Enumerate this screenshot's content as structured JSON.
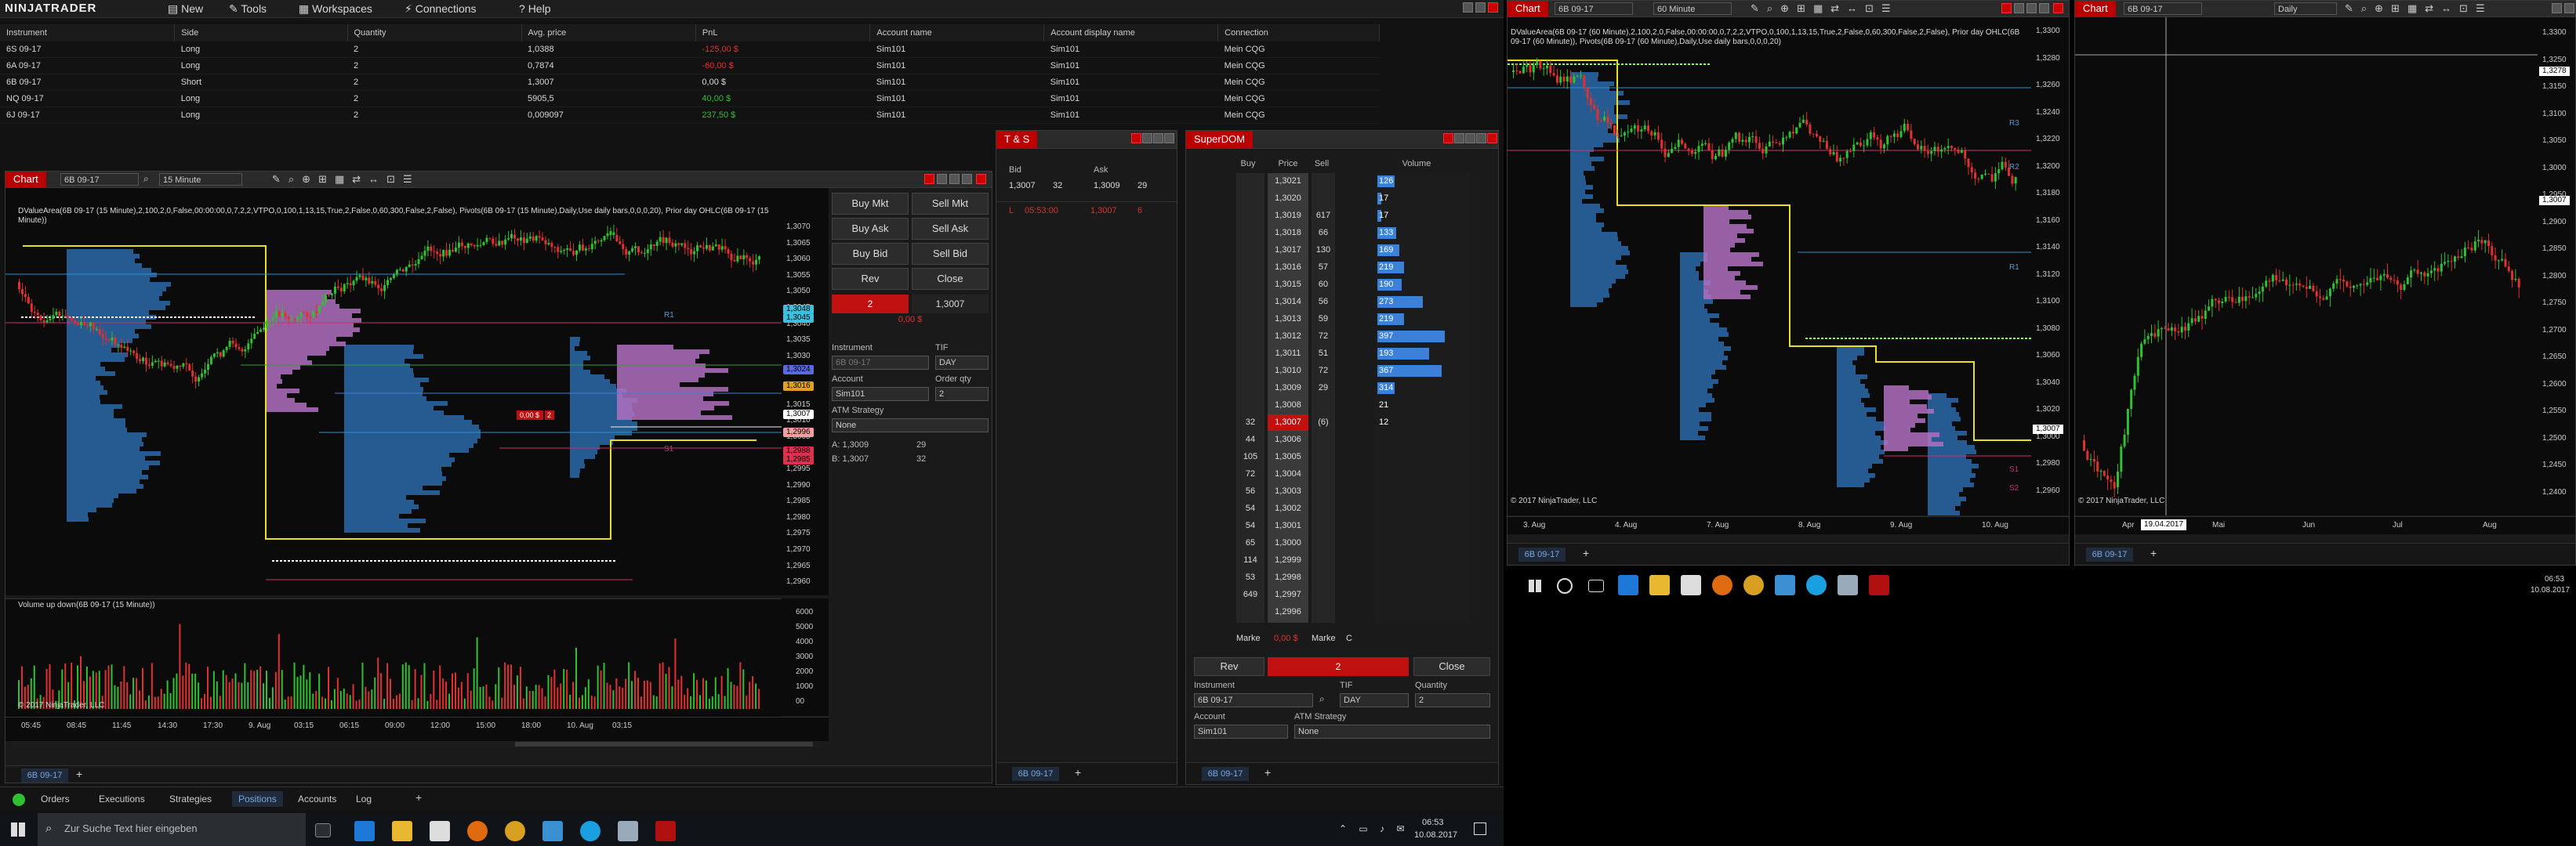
{
  "app": {
    "brand": "NINJATRADER",
    "menu": [
      "New",
      "Tools",
      "Workspaces",
      "Connections",
      "Help"
    ]
  },
  "positions": {
    "columns": [
      "Instrument",
      "Side",
      "Quantity",
      "Avg. price",
      "PnL",
      "Account name",
      "Account display name",
      "Connection"
    ],
    "rows": [
      {
        "instrument": "6S 09-17",
        "side": "Long",
        "qty": "2",
        "avg": "1,0388",
        "pnl": "-125,00 $",
        "pnl_color": "#e03030",
        "account": "Sim101",
        "display": "Sim101",
        "connection": "Mein CQG"
      },
      {
        "instrument": "6A 09-17",
        "side": "Long",
        "qty": "2",
        "avg": "0,7874",
        "pnl": "-60,00 $",
        "pnl_color": "#e03030",
        "account": "Sim101",
        "display": "Sim101",
        "connection": "Mein CQG"
      },
      {
        "instrument": "6B 09-17",
        "side": "Short",
        "qty": "2",
        "avg": "1,3007",
        "pnl": "0,00 $",
        "pnl_color": "#d8d8d8",
        "account": "Sim101",
        "display": "Sim101",
        "connection": "Mein CQG"
      },
      {
        "instrument": "NQ 09-17",
        "side": "Long",
        "qty": "2",
        "avg": "5905,5",
        "pnl": "40,00 $",
        "pnl_color": "#2ec02e",
        "account": "Sim101",
        "display": "Sim101",
        "connection": "Mein CQG"
      },
      {
        "instrument": "6J 09-17",
        "side": "Long",
        "qty": "2",
        "avg": "0,009097",
        "pnl": "237,50 $",
        "pnl_color": "#2ec02e",
        "account": "Sim101",
        "display": "Sim101",
        "connection": "Mein CQG"
      }
    ]
  },
  "chart1": {
    "tab": "Chart",
    "instrument": "6B 09-17",
    "interval": "15 Minute",
    "indicator_text": "DValueArea(6B 09-17 (15 Minute),2,100,2,0,False,00:00:00,0,7,2,2,VTPO,0,100,1,13,15,True,2,False,0,60,300,False,2,False), Pivots(6B 09-17 (15 Minute),Daily,Use daily bars,0,0,0,20), Prior day OHLC(6B 09-17 (15 Minute))",
    "copyright": "© 2017 NinjaTrader, LLC",
    "volume_label": "Volume up down(6B 09-17 (15 Minute))",
    "price_axis": [
      "1,3070",
      "1,3065",
      "1,3060",
      "1,3055",
      "1,3050",
      "1,3045",
      "1,3040",
      "1,3035",
      "1,3030",
      "1,3025",
      "1,3020",
      "1,3015",
      "1,3010",
      "1,3005",
      "1,3000",
      "1,2995",
      "1,2990",
      "1,2985",
      "1,2980",
      "1,2975",
      "1,2970",
      "1,2965",
      "1,2960"
    ],
    "price_tags": [
      {
        "text": "1,3048",
        "color": "#3cc0e0"
      },
      {
        "text": "1,3045",
        "color": "#3cc0e0"
      },
      {
        "text": "1,3024",
        "color": "#5a6ad8"
      },
      {
        "text": "1,3016",
        "color": "#e0a020"
      },
      {
        "text": "1,3007",
        "color": "#ffffff"
      },
      {
        "text": "1,2996",
        "color": "#f0a0a0"
      },
      {
        "text": "1,2988",
        "color": "#e03050"
      },
      {
        "text": "1,2985",
        "color": "#e03050"
      }
    ],
    "volume_axis": [
      "6000",
      "5000",
      "4000",
      "3000",
      "2000",
      "1000",
      "00"
    ],
    "time_axis": [
      "05:45",
      "08:45",
      "11:45",
      "14:30",
      "17:30",
      "9. Aug",
      "03:15",
      "06:15",
      "09:00",
      "12:00",
      "15:00",
      "18:00",
      "10. Aug",
      "03:15"
    ],
    "r1": "R1",
    "s1": "S1",
    "order_marker": "0,00 $",
    "order_qty": "2",
    "bottom_tab": "6B 09-17"
  },
  "chart_trader": {
    "buy_mkt": "Buy Mkt",
    "sell_mkt": "Sell Mkt",
    "buy_ask": "Buy Ask",
    "sell_ask": "Sell Ask",
    "buy_bid": "Buy Bid",
    "sell_bid": "Sell Bid",
    "rev": "Rev",
    "close": "Close",
    "pos_qty": "2",
    "pos_price": "1,3007",
    "pos_pnl": "0,00 $",
    "instrument_label": "Instrument",
    "instrument": "6B 09-17",
    "tif_label": "TIF",
    "tif": "DAY",
    "account_label": "Account",
    "account": "Sim101",
    "qty_label": "Order qty",
    "qty": "2",
    "atm_label": "ATM Strategy",
    "atm": "None",
    "a_label": "A:",
    "a_price": "1,3009",
    "a_size": "29",
    "b_label": "B:",
    "b_price": "1,3007",
    "b_size": "32"
  },
  "ts": {
    "title": "T & S",
    "bid_label": "Bid",
    "ask_label": "Ask",
    "bid": "1,3007",
    "bid_size": "32",
    "ask": "1,3009",
    "ask_size": "29",
    "row_marker": "L",
    "row_time": "05:53:00",
    "row_price": "1,3007",
    "row_size": "6",
    "bottom_tab": "6B 09-17"
  },
  "superdom": {
    "title": "SuperDOM",
    "cols": [
      "Buy",
      "Price",
      "Sell",
      "Volume"
    ],
    "rows": [
      {
        "buy": "",
        "price": "1,3021",
        "sell": "",
        "vol": "126",
        "vw": 22
      },
      {
        "buy": "",
        "price": "1,3020",
        "sell": "",
        "vol": "17",
        "vw": 5
      },
      {
        "buy": "",
        "price": "1,3019",
        "sell": "617",
        "vol": "17",
        "vw": 5
      },
      {
        "buy": "",
        "price": "1,3018",
        "sell": "66",
        "vol": "133",
        "vw": 24
      },
      {
        "buy": "",
        "price": "1,3017",
        "sell": "130",
        "vol": "169",
        "vw": 28
      },
      {
        "buy": "",
        "price": "1,3016",
        "sell": "57",
        "vol": "219",
        "vw": 34
      },
      {
        "buy": "",
        "price": "1,3015",
        "sell": "60",
        "vol": "190",
        "vw": 31
      },
      {
        "buy": "",
        "price": "1,3014",
        "sell": "56",
        "vol": "273",
        "vw": 58
      },
      {
        "buy": "",
        "price": "1,3013",
        "sell": "59",
        "vol": "219",
        "vw": 34
      },
      {
        "buy": "",
        "price": "1,3012",
        "sell": "72",
        "vol": "397",
        "vw": 86
      },
      {
        "buy": "",
        "price": "1,3011",
        "sell": "51",
        "vol": "193",
        "vw": 66
      },
      {
        "buy": "",
        "price": "1,3010",
        "sell": "72",
        "vol": "367",
        "vw": 82
      },
      {
        "buy": "",
        "price": "1,3009",
        "sell": "29",
        "vol": "314",
        "vw": 22
      },
      {
        "buy": "",
        "price": "1,3008",
        "sell": "",
        "vol": "21",
        "vw": 0
      },
      {
        "buy": "32",
        "price": "1,3007",
        "sell": "(6)",
        "vol": "12",
        "vw": 0
      },
      {
        "buy": "44",
        "price": "1,3006",
        "sell": "",
        "vol": "",
        "vw": 0
      },
      {
        "buy": "105",
        "price": "1,3005",
        "sell": "",
        "vol": "",
        "vw": 0
      },
      {
        "buy": "72",
        "price": "1,3004",
        "sell": "",
        "vol": "",
        "vw": 0
      },
      {
        "buy": "56",
        "price": "1,3003",
        "sell": "",
        "vol": "",
        "vw": 0
      },
      {
        "buy": "54",
        "price": "1,3002",
        "sell": "",
        "vol": "",
        "vw": 0
      },
      {
        "buy": "54",
        "price": "1,3001",
        "sell": "",
        "vol": "",
        "vw": 0
      },
      {
        "buy": "65",
        "price": "1,3000",
        "sell": "",
        "vol": "",
        "vw": 0
      },
      {
        "buy": "114",
        "price": "1,2999",
        "sell": "",
        "vol": "",
        "vw": 0
      },
      {
        "buy": "53",
        "price": "1,2998",
        "sell": "",
        "vol": "",
        "vw": 0
      },
      {
        "buy": "649",
        "price": "1,2997",
        "sell": "",
        "vol": "",
        "vw": 0
      },
      {
        "buy": "",
        "price": "1,2996",
        "sell": "",
        "vol": "",
        "vw": 0
      }
    ],
    "market_left": "Marke",
    "market_pnl": "0,00 $",
    "market_right": "Marke",
    "c_label": "C",
    "rev": "Rev",
    "qty": "2",
    "close": "Close",
    "instrument_label": "Instrument",
    "instrument": "6B 09-17",
    "tif_label": "TIF",
    "tif": "DAY",
    "quantity_label": "Quantity",
    "quantity": "2",
    "account_label": "Account",
    "account": "Sim101",
    "atm_label": "ATM Strategy",
    "atm": "None",
    "bottom_tab": "6B 09-17"
  },
  "chart2": {
    "tab": "Chart",
    "instrument": "6B 09-17",
    "interval": "60 Minute",
    "indicator_text": "DValueArea(6B 09-17 (60 Minute),2,100,2,0,False,00:00:00,0,7,2,2,VTPO,0,100,1,13,15,True,2,False,0,60,300,False,2,False), Prior day OHLC(6B 09-17 (60 Minute)), Pivots(6B 09-17 (60 Minute),Daily,Use daily bars,0,0,0,20)",
    "copyright": "© 2017 NinjaTrader, LLC",
    "price_axis": [
      "1,3300",
      "1,3280",
      "1,3260",
      "1,3240",
      "1,3220",
      "1,3200",
      "1,3180",
      "1,3160",
      "1,3140",
      "1,3120",
      "1,3100",
      "1,3080",
      "1,3060",
      "1,3040",
      "1,3020",
      "1,3000",
      "1,2980",
      "1,2960"
    ],
    "time_axis": [
      "3. Aug",
      "4. Aug",
      "7. Aug",
      "8. Aug",
      "9. Aug",
      "10. Aug"
    ],
    "last_price": "1,3007",
    "labels": [
      "R3",
      "R2",
      "R1",
      "S1",
      "S2"
    ],
    "bottom_tab": "6B 09-17"
  },
  "chart3": {
    "tab": "Chart",
    "instrument": "6B 09-17",
    "interval": "Daily",
    "copyright": "© 2017 NinjaTrader, LLC",
    "price_axis": [
      "1,3300",
      "1,3250",
      "1,3150",
      "1,3100",
      "1,3050",
      "1,3000",
      "1,2950",
      "1,2900",
      "1,2850",
      "1,2800",
      "1,2750",
      "1,2700",
      "1,2650",
      "1,2600",
      "1,2550",
      "1,2500",
      "1,2450",
      "1,2400"
    ],
    "crosshair_price": "1,3278",
    "last_price": "1,3007",
    "time_axis": [
      "Apr",
      "Mai",
      "Jun",
      "Jul",
      "Aug"
    ],
    "crosshair_date": "19.04.2017",
    "bottom_tab": "6B 09-17"
  },
  "bottom_tabs": [
    "Orders",
    "Executions",
    "Strategies",
    "Positions",
    "Accounts",
    "Log"
  ],
  "taskbar": {
    "search_placeholder": "Zur Suche Text hier eingeben",
    "time": "06:53",
    "date": "10.08.2017",
    "time2": "06:53",
    "date2": "10.08.2017"
  }
}
